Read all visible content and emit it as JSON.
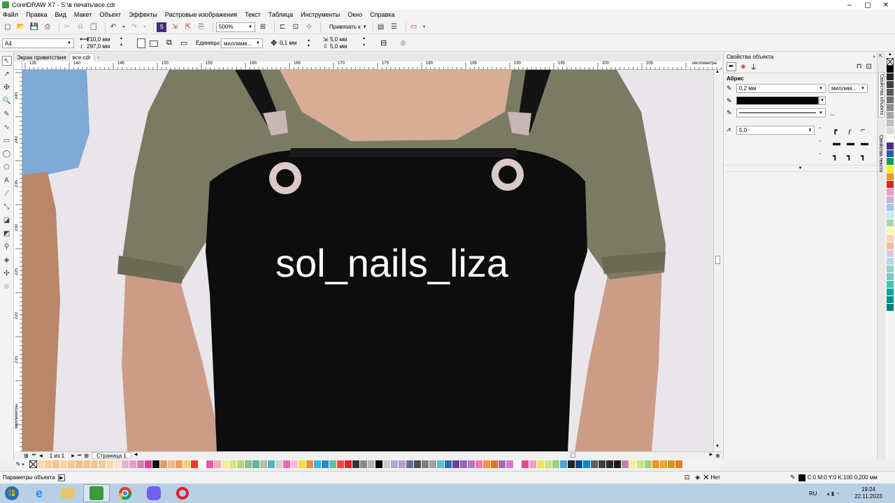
{
  "window": {
    "title": "CorelDRAW X7 - S:\\в печать\\все.cdr",
    "min": "–",
    "max": "▢",
    "close": "✕"
  },
  "menu": [
    "Файл",
    "Правка",
    "Вид",
    "Макет",
    "Объект",
    "Эффекты",
    "Растровые изображения",
    "Текст",
    "Таблица",
    "Инструменты",
    "Окно",
    "Справка"
  ],
  "toolbar": {
    "zoom": "500%",
    "snap_label": "Привязать к"
  },
  "propbar": {
    "paper": "A4",
    "width": "210,0 мм",
    "height": "297,0 мм",
    "units_label": "Единицы:",
    "units_value": "миллиме...",
    "nudge": "0,1 мм",
    "dup_x": "5,0 мм",
    "dup_y": "5,0 мм"
  },
  "tabs": {
    "welcome": "Экран приветствия",
    "doc": "все.cdr",
    "add": "+"
  },
  "ruler": {
    "h_ticks": [
      "135",
      "140",
      "145",
      "150",
      "155",
      "160",
      "165",
      "170",
      "175",
      "180",
      "185",
      "190",
      "195",
      "200",
      "205"
    ],
    "unit": "миллиметры",
    "v_ticks": [
      "245",
      "240",
      "235",
      "230",
      "225",
      "220",
      "215"
    ]
  },
  "canvas": {
    "text": "sol_nails_liza"
  },
  "pager": {
    "count": "1 из 1",
    "page": "Страница 1"
  },
  "panel": {
    "title": "Свойства объекта",
    "section": "Абрис",
    "width": "0,2 мм",
    "units": "миллим...",
    "dots": "...",
    "miter": "5,0"
  },
  "side_tabs": {
    "tab1": "Свойства объекта",
    "tab2": "Свойства текста"
  },
  "status": {
    "left": "Параметры объекта",
    "fill": "Нет",
    "outline": "C:0 M:0 Y:0 K:100  0,200 мм"
  },
  "taskbar": {
    "lang": "RU",
    "time": "19:24",
    "date": "22.11.2023"
  },
  "colors": {
    "bottom_palette": [
      "#ffd8a8",
      "#f7cc95",
      "#f5c28a",
      "#fbd3a6",
      "#f8c58f",
      "#f4bb86",
      "#f2c48f",
      "#eec596",
      "#f3c995",
      "#f8d9b0",
      "#fae2c2",
      "#e9b2d1",
      "#e79fc3",
      "#d980b3",
      "#e43a8e",
      "#111111",
      "#d2a071",
      "#f4b78b",
      "#f29c64",
      "#f7d16f",
      "#ee3b32",
      "#ffffff",
      "#ee5a9b",
      "#f7a8c0",
      "#f6f09c",
      "#d9e47b",
      "#b8d37d",
      "#8cc385",
      "#5fb49a",
      "#aebfa6",
      "#55b3c2",
      "#d1d1d1",
      "#ef6aa8",
      "#f8bfd9",
      "#f7dd3d",
      "#ef8f36",
      "#3fb1e7",
      "#1f8dd6",
      "#64bfa4",
      "#f04b3e",
      "#e41e2a",
      "#333333",
      "#8a8a8a",
      "#b3b3b3",
      "#000000",
      "#c9c9c9",
      "#a8a8d8",
      "#b99ad1",
      "#6b6b9a",
      "#4d4d4d",
      "#7b7b7b",
      "#a0a0a0",
      "#5bbfce",
      "#2f6eb5",
      "#6d3f9a",
      "#9a5fb8",
      "#b07acb",
      "#ef77b0",
      "#f2943f",
      "#e66e2c",
      "#9b6fbd",
      "#d879c6",
      "#ffffff",
      "#e34a8d",
      "#e7a2c9",
      "#f5e05a",
      "#cfe27a",
      "#9ad07d",
      "#4aa4d8",
      "#222222",
      "#004c8c",
      "#008ad0",
      "#5f5f5f",
      "#3d3d3d",
      "#2a2a2a",
      "#1a1a1a",
      "#c47db4",
      "#f3ef94",
      "#c9e388",
      "#a6d36f",
      "#f7941d",
      "#f0a22d",
      "#d49520",
      "#e87d1e"
    ],
    "side_palette": [
      "#000000",
      "#262626",
      "#404040",
      "#595959",
      "#737373",
      "#8c8c8c",
      "#a6a6a6",
      "#bfbfbf",
      "#d9d9d9",
      "#ffffff",
      "#4a2c91",
      "#2e5aa7",
      "#00a651",
      "#fff200",
      "#f7941d",
      "#ed1c24",
      "#f49ac1",
      "#c7b2d6",
      "#a3c4e7",
      "#cfe7f6",
      "#a0d8b3",
      "#fff9ae",
      "#fcd5b4",
      "#f7b7a3",
      "#e2c6e0",
      "#bad5ee",
      "#9cd0c2",
      "#7ccbc1",
      "#40c4b6",
      "#00a99d",
      "#00948e",
      "#007f7a"
    ]
  }
}
